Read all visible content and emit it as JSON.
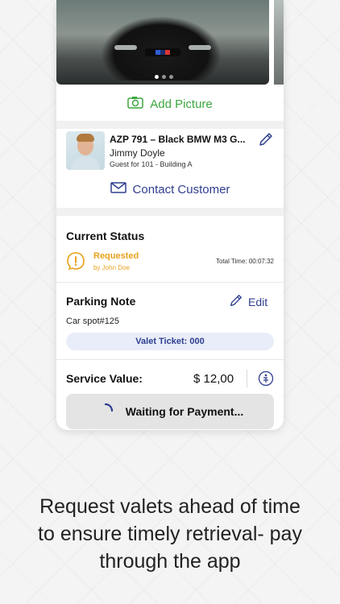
{
  "add_picture": {
    "label": "Add Picture"
  },
  "vehicle": {
    "title": "AZP 791 – Black BMW M3 G...",
    "guest_name": "Jimmy Doyle",
    "guest_info": "Guest for 101 - Building A"
  },
  "contact": {
    "label": "Contact Customer"
  },
  "status": {
    "section_title": "Current Status",
    "value": "Requested",
    "by": "by John Doe",
    "total_time": "Total Time: 00:07:32"
  },
  "parking_note": {
    "section_title": "Parking Note",
    "edit_label": "Edit",
    "note": "Car spot#125",
    "ticket": "Valet Ticket: 000"
  },
  "service": {
    "label": "Service Value:",
    "price": "$ 12,00"
  },
  "payment": {
    "waiting_label": "Waiting for Payment..."
  },
  "caption": {
    "line1": "Request valets ahead of time",
    "line2": "to ensure timely retrieval- pay",
    "line3": "through the app"
  },
  "carousel": {
    "pages": 3,
    "active_index": 0
  },
  "colors": {
    "accent_green": "#3ca63f",
    "accent_blue": "#2f3e8f",
    "status_orange": "#e9a11c"
  },
  "icons": [
    "camera-icon",
    "pencil-icon",
    "mail-icon",
    "status-alert-icon",
    "info-icon",
    "spinner-icon"
  ]
}
